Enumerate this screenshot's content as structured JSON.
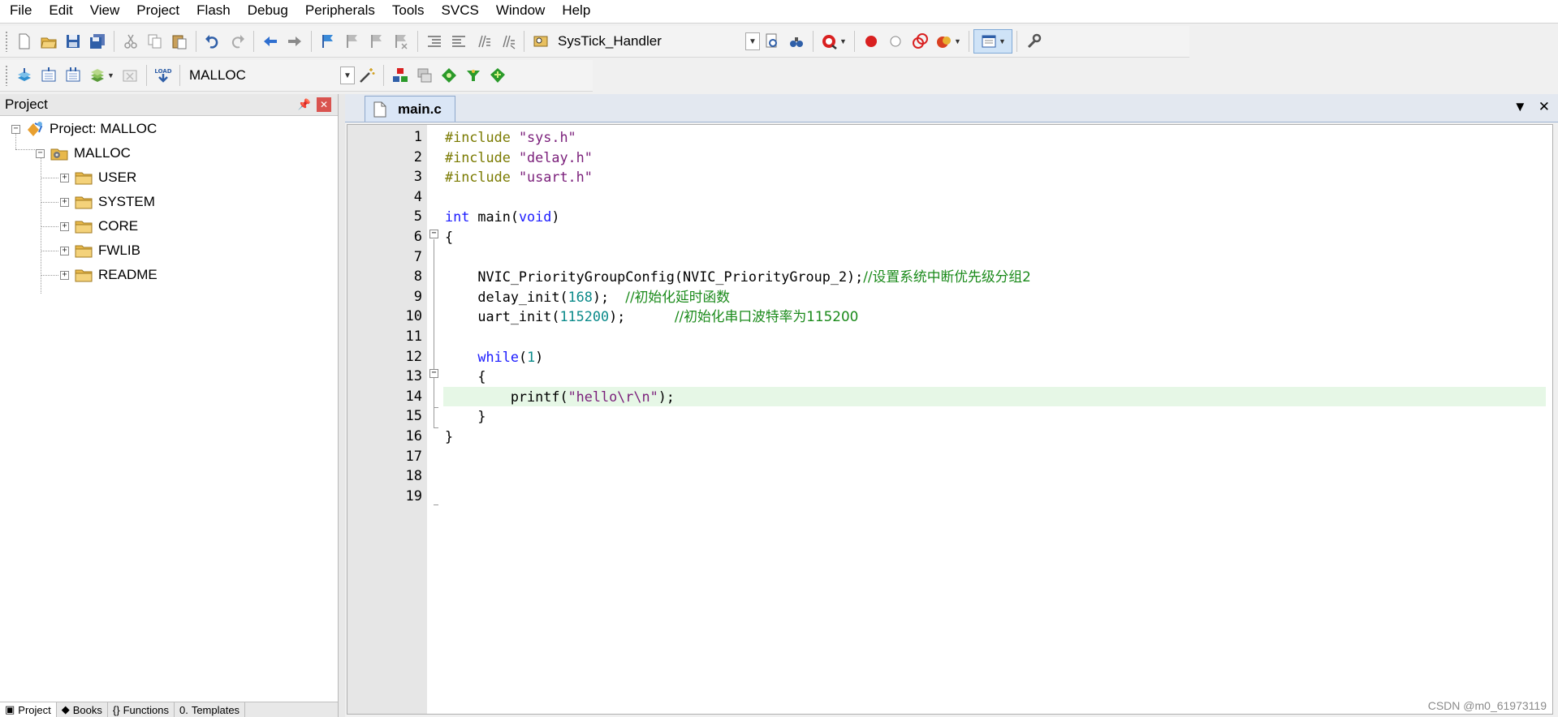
{
  "menu": [
    "File",
    "Edit",
    "View",
    "Project",
    "Flash",
    "Debug",
    "Peripherals",
    "Tools",
    "SVCS",
    "Window",
    "Help"
  ],
  "toolbar1": {
    "function_combo_value": "SysTick_Handler"
  },
  "toolbar2": {
    "target_combo_value": "MALLOC",
    "load_label": "LOAD"
  },
  "project_panel": {
    "title": "Project",
    "pin_icon": "pin-icon",
    "close_icon": "close-icon",
    "root": "Project: MALLOC",
    "target": "MALLOC",
    "groups": [
      "USER",
      "SYSTEM",
      "CORE",
      "FWLIB",
      "README"
    ],
    "bottom_tabs": [
      "Project",
      "Books",
      "Functions",
      "Templates"
    ]
  },
  "editor": {
    "tab_label": "main.c",
    "lines": [
      {
        "num": "1",
        "tokens": [
          [
            "prep",
            "#include "
          ],
          [
            "str",
            "\"sys.h\""
          ]
        ]
      },
      {
        "num": "2",
        "tokens": [
          [
            "prep",
            "#include "
          ],
          [
            "str",
            "\"delay.h\""
          ]
        ]
      },
      {
        "num": "3",
        "tokens": [
          [
            "prep",
            "#include "
          ],
          [
            "str",
            "\"usart.h\""
          ]
        ]
      },
      {
        "num": "4",
        "tokens": []
      },
      {
        "num": "5",
        "tokens": [
          [
            "kw",
            "int"
          ],
          [
            "plain",
            " main("
          ],
          [
            "kw",
            "void"
          ],
          [
            "plain",
            ")"
          ]
        ]
      },
      {
        "num": "6",
        "tokens": [
          [
            "plain",
            "{"
          ]
        ]
      },
      {
        "num": "7",
        "tokens": []
      },
      {
        "num": "8",
        "tokens": [
          [
            "plain",
            "    NVIC_PriorityGroupConfig(NVIC_PriorityGroup_2);"
          ],
          [
            "cmt",
            "//设置系统中断优先级分组2"
          ]
        ]
      },
      {
        "num": "9",
        "tokens": [
          [
            "plain",
            "    delay_init("
          ],
          [
            "num",
            "168"
          ],
          [
            "plain",
            ");  "
          ],
          [
            "cmt",
            "//初始化延时函数"
          ]
        ]
      },
      {
        "num": "10",
        "tokens": [
          [
            "plain",
            "    uart_init("
          ],
          [
            "num",
            "115200"
          ],
          [
            "plain",
            ");      "
          ],
          [
            "cmt",
            "//初始化串口波特率为115200"
          ]
        ]
      },
      {
        "num": "11",
        "tokens": []
      },
      {
        "num": "12",
        "tokens": [
          [
            "plain",
            "    "
          ],
          [
            "kw",
            "while"
          ],
          [
            "plain",
            "("
          ],
          [
            "num",
            "1"
          ],
          [
            "plain",
            ")"
          ]
        ]
      },
      {
        "num": "13",
        "tokens": [
          [
            "plain",
            "    {"
          ]
        ]
      },
      {
        "num": "14",
        "tokens": [
          [
            "plain",
            "        printf("
          ],
          [
            "str",
            "\"hello\\r\\n\""
          ],
          [
            "plain",
            ");"
          ]
        ]
      },
      {
        "num": "15",
        "tokens": [
          [
            "plain",
            "    }"
          ]
        ]
      },
      {
        "num": "16",
        "tokens": [
          [
            "plain",
            "}"
          ]
        ]
      },
      {
        "num": "17",
        "tokens": []
      },
      {
        "num": "18",
        "tokens": []
      },
      {
        "num": "19",
        "tokens": []
      }
    ],
    "current_line": "14"
  },
  "watermark": "CSDN @m0_61973119"
}
